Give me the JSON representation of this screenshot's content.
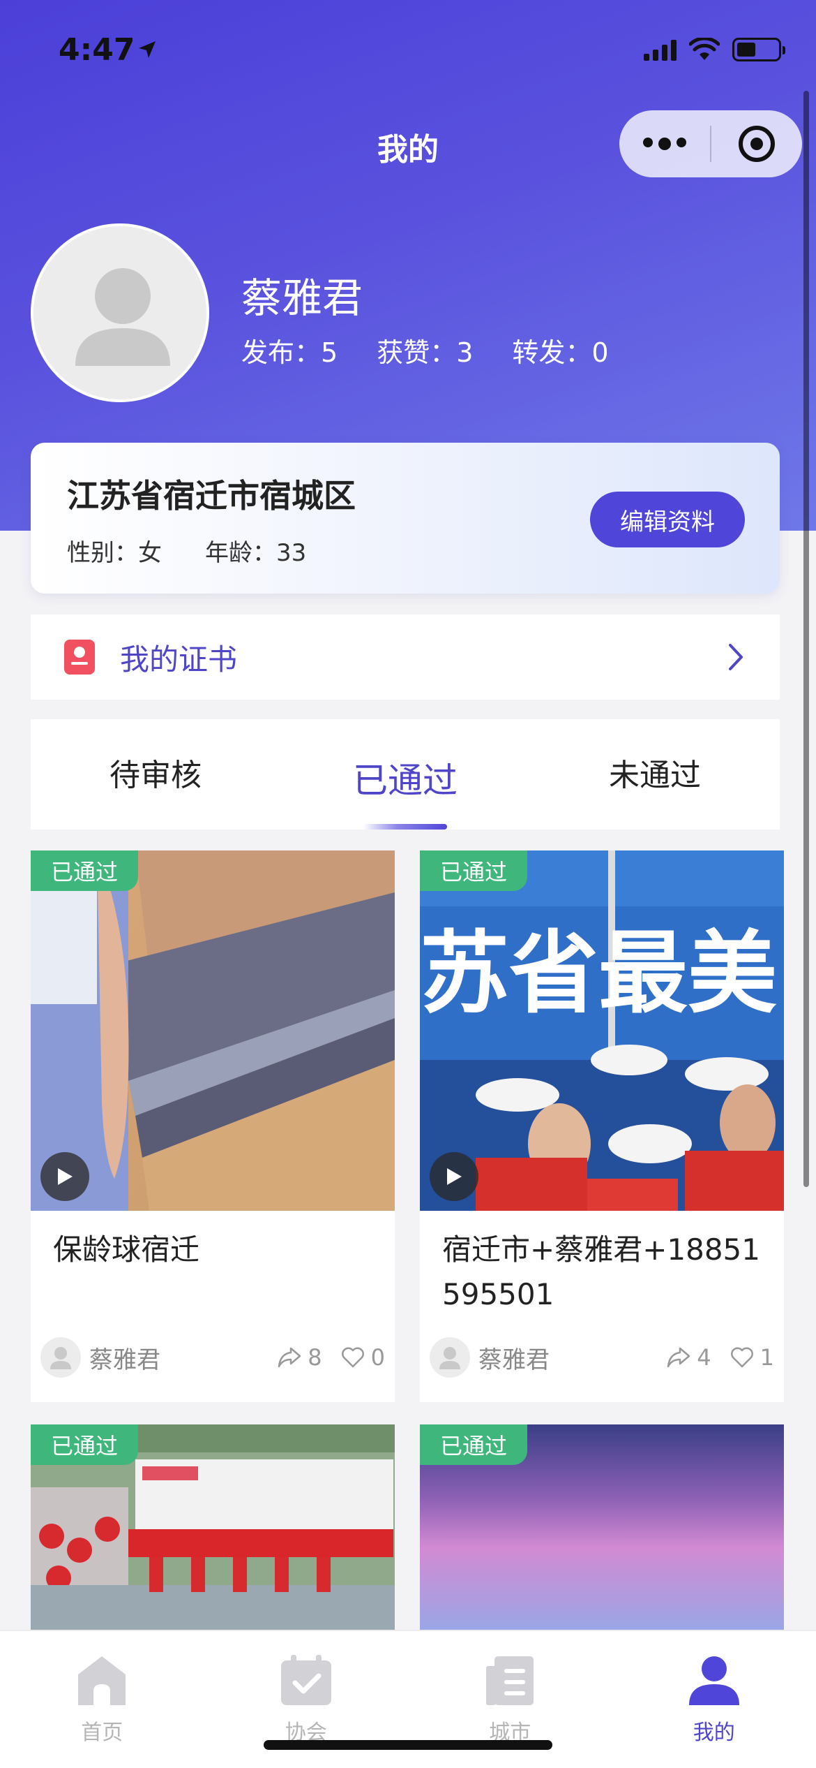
{
  "status_bar": {
    "time": "4:47"
  },
  "nav": {
    "title": "我的"
  },
  "profile": {
    "name": "蔡雅君",
    "stats": [
      {
        "label": "发布：",
        "value": "5"
      },
      {
        "label": "获赞：",
        "value": "3"
      },
      {
        "label": "转发：",
        "value": "0"
      }
    ]
  },
  "info": {
    "location": "江苏省宿迁市宿城区",
    "gender_label": "性别：",
    "gender": "女",
    "age_label": "年龄：",
    "age": "33",
    "edit_label": "编辑资料"
  },
  "certificate": {
    "label": "我的证书"
  },
  "tabs": [
    {
      "label": "待审核",
      "active": false
    },
    {
      "label": "已通过",
      "active": true
    },
    {
      "label": "未通过",
      "active": false
    }
  ],
  "posts": [
    {
      "badge": "已通过",
      "title": "保龄球宿迁",
      "author": "蔡雅君",
      "shares": "8",
      "likes": "0",
      "video": true
    },
    {
      "badge": "已通过",
      "title": "宿迁市+蔡雅君+18851595501",
      "author": "蔡雅君",
      "shares": "4",
      "likes": "1",
      "video": true,
      "thumb_text": "苏省最美"
    },
    {
      "badge": "已通过"
    },
    {
      "badge": "已通过"
    }
  ],
  "tabbar": [
    {
      "label": "首页",
      "icon": "home-icon",
      "active": false
    },
    {
      "label": "协会",
      "icon": "association-icon",
      "active": false
    },
    {
      "label": "城市",
      "icon": "city-icon",
      "active": false
    },
    {
      "label": "我的",
      "icon": "profile-icon",
      "active": true
    }
  ],
  "colors": {
    "primary": "#4f45d9",
    "approved_badge": "#3fb67c",
    "certificate_icon": "#f0505f"
  }
}
